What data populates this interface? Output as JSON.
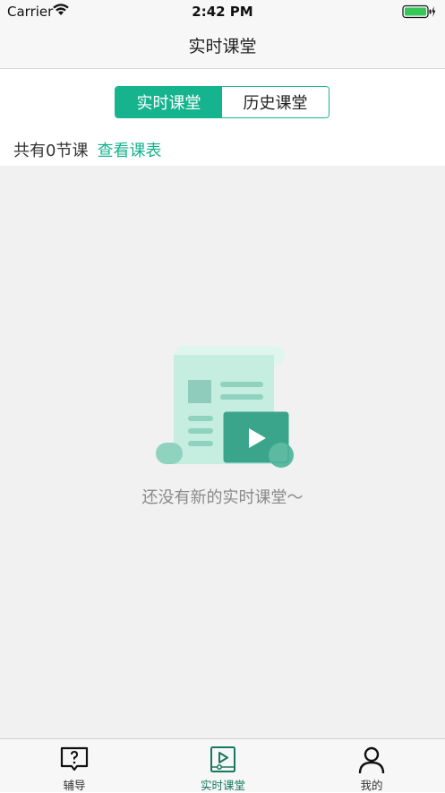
{
  "status_bar": {
    "carrier": "Carrier",
    "time": "2:42 PM"
  },
  "nav": {
    "title": "实时课堂"
  },
  "segmented": {
    "options": [
      "实时课堂",
      "历史课堂"
    ],
    "selected": "实时课堂"
  },
  "summary": {
    "count_text": "共有0节课",
    "schedule_link": "查看课表"
  },
  "empty_state": {
    "message": "还没有新的实时课堂～",
    "illustration_icon": "document-video-icon"
  },
  "tab_bar": {
    "items": [
      {
        "label": "辅导",
        "icon": "question-chat-icon",
        "active": false
      },
      {
        "label": "实时课堂",
        "icon": "video-play-icon",
        "active": true
      },
      {
        "label": "我的",
        "icon": "person-icon",
        "active": false
      }
    ]
  },
  "colors": {
    "accent": "#16b38f",
    "background": "#f0f1f0",
    "active_tab": "#16795f"
  }
}
